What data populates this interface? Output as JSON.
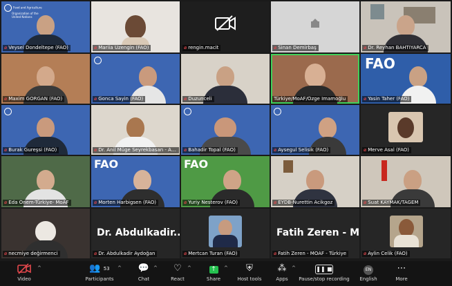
{
  "participants": [
    {
      "name": "Veysel Dondeltepe (FAO)",
      "fao_org_line1": "Food and Agriculture",
      "fao_org_line2": "Organization of the",
      "fao_org_line3": "United Nations"
    },
    {
      "name": "Mariia Uzengin (FAO)"
    },
    {
      "name": "rengin.macit"
    },
    {
      "name": "Sinan Demirbaş"
    },
    {
      "name": "Dr. Reyhan BAHTIYARCA"
    },
    {
      "name": "Maxim GORGAN (FAO)"
    },
    {
      "name": "Gonca Sayin (FAO)"
    },
    {
      "name": "Duzunceli"
    },
    {
      "name": "Türkiye/MoAF/Özge Imamoğlu"
    },
    {
      "name": "Yasin Taher (FAO)",
      "logo": "FAO"
    },
    {
      "name": "Burak Gureşsi (FAO)"
    },
    {
      "name": "Dr. Anil Müge Seyrekbasan - ARGO"
    },
    {
      "name": "Bahadir Topal (FAO)"
    },
    {
      "name": "Aysegul Selisik (FAO)"
    },
    {
      "name": "Merve Asal (FAO)"
    },
    {
      "name": "Eda Önem-Türkiye- MoAF"
    },
    {
      "name": "Morten Harbigsen (FAO)",
      "logo": "FAO"
    },
    {
      "name": "Yuriy Nesterov (FAO)",
      "logo": "FAO"
    },
    {
      "name": "EYDB-Nurettin Acikgoz"
    },
    {
      "name": "Suat KAYMAK/TAGEM"
    },
    {
      "name": "necmiye değirmenci"
    },
    {
      "name": "Dr. Abdulkadir Aydoğan",
      "display_name": "Dr. Abdulkadir..."
    },
    {
      "name": "Mertcan Turan (FAO)"
    },
    {
      "name": "Fatih Zeren - MOAF - Türkiye",
      "display_name": "Fatih Zeren - M..."
    },
    {
      "name": "Aylin Celik (FAO)"
    }
  ],
  "toolbar": {
    "video": "Video",
    "participants": "Participants",
    "participants_count": "53",
    "chat": "Chat",
    "react": "React",
    "share": "Share",
    "host_tools": "Host tools",
    "apps": "Apps",
    "recording": "Pause/stop recording",
    "english": "English",
    "english_badge": "EN",
    "more": "More"
  },
  "colors": {
    "active_speaker": "#3fd15a",
    "fao_blue": "#2f5ea9",
    "muted_red": "#e5484d",
    "share_green": "#25c14f"
  }
}
